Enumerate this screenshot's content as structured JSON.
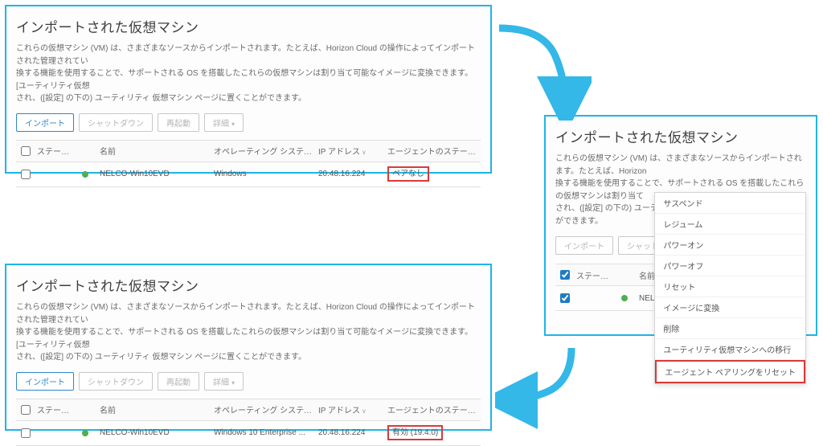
{
  "common": {
    "title": "インポートされた仮想マシン",
    "descL1": "これらの仮想マシン (VM) は、さまざまなソースからインポートされます。たとえば、Horizon Cloud の操作によってインポートされた管理されてい",
    "descL2": "換する機能を使用することで、サポートされる OS を搭載したこれらの仮想マシンは割り当て可能なイメージに変換できます。[ユーティリティ仮想",
    "descL3": "され、([設定] の下の) ユーティリティ 仮想マシン ページに置くことができます。",
    "descS1": "これらの仮想マシン (VM) は、さまざまなソースからインポートされます。たとえば、Horizon",
    "descS2": "換する機能を使用することで、サポートされる OS を搭載したこれらの仮想マシンは割り当て",
    "descS3": "され、([設定] の下の) ユーティリティ 仮想マシン ページに置くことができます。",
    "btn_import": "インポート",
    "btn_shutdown": "シャットダウン",
    "btn_restart": "再起動",
    "btn_more": "詳細",
    "hdr_status": "ステー...",
    "hdr_name": "名前",
    "hdr_os": "オペレーティング システム",
    "hdr_ip": "IP アドレス",
    "hdr_agent": "エージェントのステータス",
    "hdr_system": "ステム",
    "vm_name": "NELCO-Win10EVD"
  },
  "panel1": {
    "os": "Windows",
    "ip": "20.48.16.224",
    "agent": "ペアなし"
  },
  "panel3": {
    "os": "Windows 10 Enterprise ...",
    "ip": "20.48.16.224",
    "agent": "有効 (19.4.0)"
  },
  "menu": {
    "items": [
      "サスペンド",
      "レジューム",
      "パワーオン",
      "パワーオフ",
      "リセット",
      "イメージに変換",
      "削除",
      "ユーティリティ仮想マシンへの移行"
    ],
    "reset_pairing": "エージェント ペアリングをリセット"
  }
}
